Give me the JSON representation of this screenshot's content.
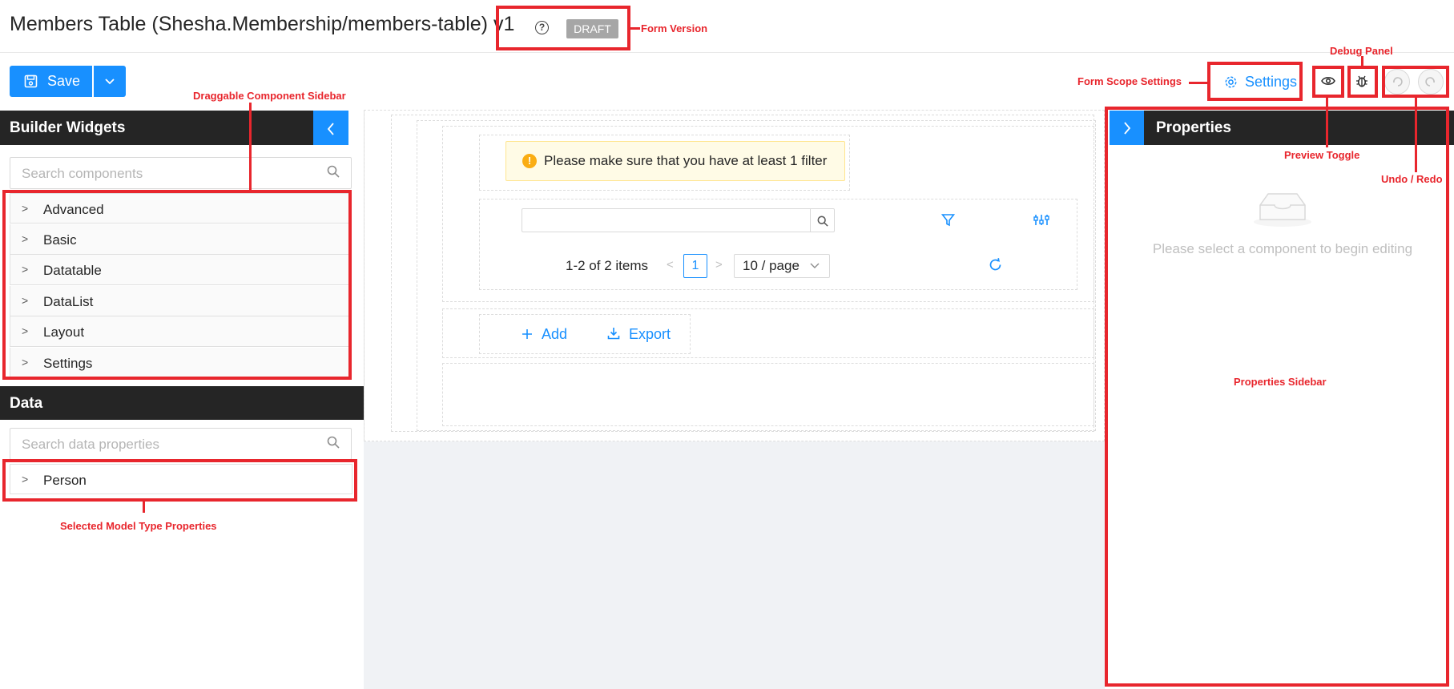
{
  "header": {
    "title": "Members Table (Shesha.Membership/members-table) v1",
    "help_glyph": "?",
    "status_badge": "DRAFT"
  },
  "toolbar": {
    "save_label": "Save",
    "settings_label": "Settings"
  },
  "left_sidebar": {
    "widgets_title": "Builder Widgets",
    "search_placeholder": "Search components",
    "groups": [
      "Advanced",
      "Basic",
      "Datatable",
      "DataList",
      "Layout",
      "Settings"
    ],
    "data_title": "Data",
    "data_search_placeholder": "Search data properties",
    "data_items": [
      "Person"
    ]
  },
  "canvas": {
    "alert_text": "Please make sure that you have at least 1 filter",
    "pagination_summary": "1-2 of 2 items",
    "current_page": "1",
    "page_size": "10 / page",
    "add_label": "Add",
    "export_label": "Export"
  },
  "right_sidebar": {
    "title": "Properties",
    "empty_text": "Please select a component to begin editing"
  },
  "annotations": {
    "form_version": "Form Version",
    "debug_panel": "Debug Panel",
    "form_scope_settings": "Form Scope Settings",
    "draggable_sidebar": "Draggable Component Sidebar",
    "preview_toggle": "Preview Toggle",
    "undo_redo": "Undo / Redo",
    "properties_sidebar": "Properties Sidebar",
    "selected_model_props": "Selected Model Type Properties"
  },
  "colors": {
    "primary": "#1890ff",
    "sidebar_header": "#252525",
    "annotation": "#e8262d",
    "alert_bg": "#fffbe6",
    "canvas_bg": "#f0f2f5"
  },
  "icons": [
    "save-icon",
    "chevron-down-icon",
    "gear-icon",
    "eye-icon",
    "bug-icon",
    "undo-icon",
    "redo-icon",
    "search-icon",
    "filter-icon",
    "column-settings-icon",
    "refresh-icon",
    "plus-icon",
    "download-icon",
    "inbox-icon",
    "warning-icon"
  ]
}
